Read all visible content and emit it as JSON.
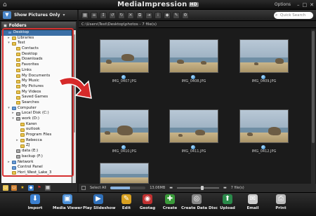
{
  "app": {
    "title": "MediaImpression",
    "badge": "HD",
    "options": "Options"
  },
  "left": {
    "filter": "Show Pictures Only",
    "folders_label": "Folders",
    "tree": [
      {
        "label": "Desktop",
        "indent": 0,
        "selected": true,
        "exp": "",
        "icon": "blue"
      },
      {
        "label": "Libraries",
        "indent": 1,
        "exp": "+",
        "icon": "yellow"
      },
      {
        "label": "Test",
        "indent": 1,
        "exp": "-",
        "icon": "yellow"
      },
      {
        "label": "Contacts",
        "indent": 2,
        "exp": "",
        "icon": "yellow"
      },
      {
        "label": "Desktop",
        "indent": 2,
        "exp": "",
        "icon": "yellow"
      },
      {
        "label": "Downloads",
        "indent": 2,
        "exp": "",
        "icon": "yellow"
      },
      {
        "label": "Favorites",
        "indent": 2,
        "exp": "",
        "icon": "yellow"
      },
      {
        "label": "Links",
        "indent": 2,
        "exp": "",
        "icon": "yellow"
      },
      {
        "label": "My Documents",
        "indent": 2,
        "exp": "",
        "icon": "yellow"
      },
      {
        "label": "My Music",
        "indent": 2,
        "exp": "",
        "icon": "yellow"
      },
      {
        "label": "My Pictures",
        "indent": 2,
        "exp": "",
        "icon": "yellow"
      },
      {
        "label": "My Videos",
        "indent": 2,
        "exp": "",
        "icon": "yellow"
      },
      {
        "label": "Saved Games",
        "indent": 2,
        "exp": "",
        "icon": "yellow"
      },
      {
        "label": "Searches",
        "indent": 2,
        "exp": "",
        "icon": "yellow"
      },
      {
        "label": "Computer",
        "indent": 1,
        "exp": "-",
        "icon": "blue"
      },
      {
        "label": "Local Disk (C:)",
        "indent": 2,
        "exp": "+",
        "icon": "drive"
      },
      {
        "label": "work (D:)",
        "indent": 2,
        "exp": "-",
        "icon": "drive"
      },
      {
        "label": "Karen",
        "indent": 3,
        "exp": "",
        "icon": "yellow"
      },
      {
        "label": "outlook",
        "indent": 3,
        "exp": "",
        "icon": "yellow"
      },
      {
        "label": "Program Files",
        "indent": 3,
        "exp": "",
        "icon": "yellow"
      },
      {
        "label": "Rebecca",
        "indent": 3,
        "exp": "+",
        "icon": "yellow"
      },
      {
        "label": "ZJ",
        "indent": 3,
        "exp": "",
        "icon": "yellow"
      },
      {
        "label": "data (E:)",
        "indent": 2,
        "exp": "",
        "icon": "drive"
      },
      {
        "label": "backup (F:)",
        "indent": 2,
        "exp": "",
        "icon": "drive"
      },
      {
        "label": "Network",
        "indent": 1,
        "exp": "+",
        "icon": "blue"
      },
      {
        "label": "Control Panel",
        "indent": 1,
        "exp": "",
        "icon": "blue"
      },
      {
        "label": "Hori_West_Lake_3",
        "indent": 1,
        "exp": "",
        "icon": "yellow"
      }
    ]
  },
  "right": {
    "path": "C:\\Users\\Test\\Desktop\\photos - 7 file(s)",
    "search_placeholder": "Quick Search",
    "thumbnails": [
      "IMG_0407.JPG",
      "IMG_0408.JPG",
      "IMG_0409.JPG",
      "IMG_0410.JPG",
      "IMG_0411.JPG",
      "IMG_0412.JPG",
      ""
    ],
    "status": {
      "select_all": "Select All",
      "size": "13.06MB",
      "count": "7 file(s)",
      "progress_fraction": 0.55,
      "zoom_fraction": 0.6
    }
  },
  "toolbar": [
    {
      "label": "Import",
      "icon": "import-icon",
      "glyph": "⬇",
      "color": "#3a7fd0"
    },
    {
      "label": "Media Viewer",
      "icon": "media-viewer-icon",
      "glyph": "▣",
      "color": "#4a8fd8"
    },
    {
      "label": "Play Slideshow",
      "icon": "slideshow-icon",
      "glyph": "▶",
      "color": "#2f6fb8"
    },
    {
      "label": "Edit",
      "icon": "edit-icon",
      "glyph": "✎",
      "color": "#d8a020"
    },
    {
      "label": "Geotag",
      "icon": "geotag-icon",
      "glyph": "◉",
      "color": "#c03030"
    },
    {
      "label": "Create",
      "icon": "create-icon",
      "glyph": "✚",
      "color": "#3a9a3a"
    },
    {
      "label": "Create Data Disc",
      "icon": "disc-icon",
      "glyph": "◎",
      "color": "#888888"
    },
    {
      "label": "Upload",
      "icon": "upload-icon",
      "glyph": "⬆",
      "color": "#2a8a4a"
    },
    {
      "label": "Email",
      "icon": "email-icon",
      "glyph": "✉",
      "color": "#cccccc"
    },
    {
      "label": "Print",
      "icon": "print-icon",
      "glyph": "⎙",
      "color": "#bbbbbb"
    }
  ]
}
